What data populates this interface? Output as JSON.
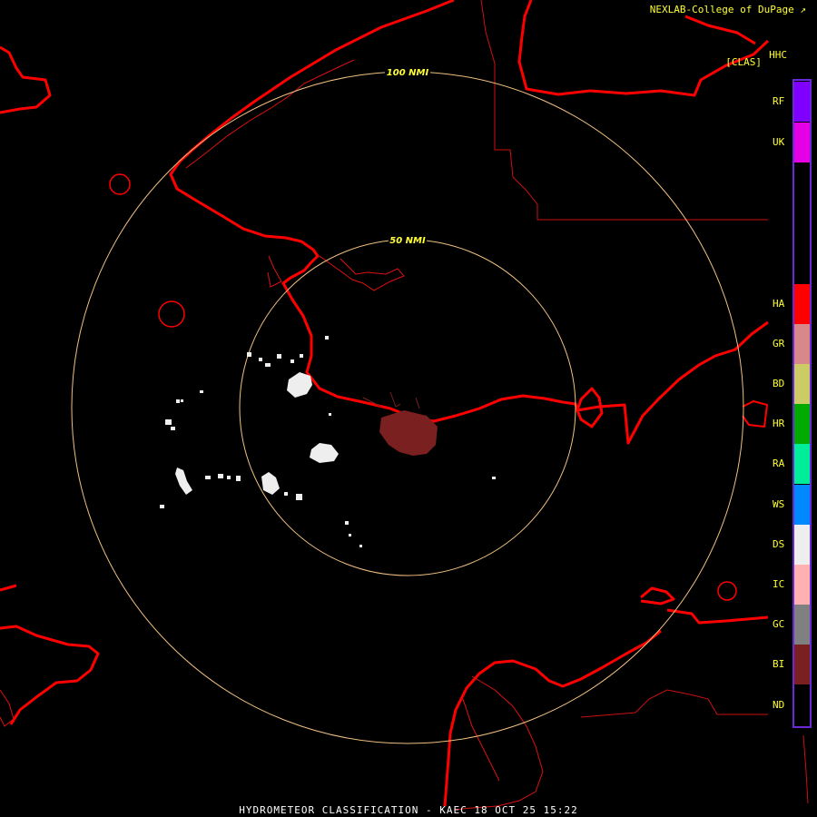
{
  "header": {
    "credit": "NEXLAB-College of DuPage",
    "credit_icon": "external-link-icon",
    "product_code": "HHC",
    "product_class": "[CLAS]"
  },
  "range_rings": [
    {
      "label": "100 NMI"
    },
    {
      "label": "50 NMI"
    }
  ],
  "legend": {
    "items": [
      {
        "code": "RF",
        "color": "#7f00ff"
      },
      {
        "code": "UK",
        "color": "#e600e6"
      },
      {
        "code": "HA",
        "color": "#ff0000"
      },
      {
        "code": "GR",
        "color": "#d88888"
      },
      {
        "code": "BD",
        "color": "#cccc66"
      },
      {
        "code": "HR",
        "color": "#00aa00"
      },
      {
        "code": "RA",
        "color": "#00ee99"
      },
      {
        "code": "WS",
        "color": "#0088ff"
      },
      {
        "code": "DS",
        "color": "#eeeeee"
      },
      {
        "code": "IC",
        "color": "#ffb0b0"
      },
      {
        "code": "GC",
        "color": "#808080"
      },
      {
        "code": "BI",
        "color": "#7a2020"
      },
      {
        "code": "ND",
        "color": "#000000"
      }
    ],
    "border_color": "#6a28d8"
  },
  "map_colors": {
    "coastline": "#ff0000",
    "boundary": "#dd1111",
    "ring": "#f0c080",
    "ring_label": "#ffff33",
    "dry_snow_echo": "#eeeeee",
    "biological_echo": "#7a2020"
  },
  "footer": {
    "caption": "HYDROMETEOR CLASSIFICATION - KAEC 18 OCT 25 15:22"
  }
}
